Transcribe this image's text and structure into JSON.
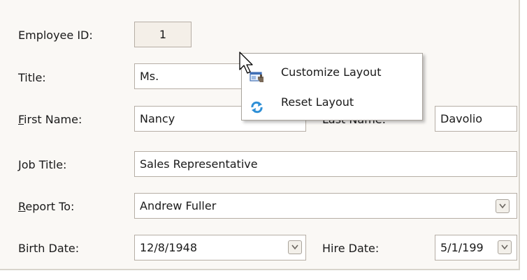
{
  "form": {
    "employee_id": {
      "label": "Employee ID:",
      "value": "1"
    },
    "title": {
      "label": "Title:",
      "value": "Ms."
    },
    "first_name": {
      "label_pre": "",
      "label_ul": "F",
      "label_post": "irst Name:",
      "value": "Nancy"
    },
    "last_name": {
      "label": "Last Name:",
      "value": "Davolio"
    },
    "job_title": {
      "label": "Job Title:",
      "value": "Sales Representative"
    },
    "report_to": {
      "label_ul": "R",
      "label_post": "eport To:",
      "value": "Andrew Fuller"
    },
    "birth_date": {
      "label": "Birth Date:",
      "value": "12/8/1948"
    },
    "hire_date": {
      "label": "Hire Date:",
      "value": "5/1/199"
    }
  },
  "context_menu": {
    "items": [
      {
        "label": "Customize Layout",
        "icon": "customize-layout-icon"
      },
      {
        "label": "Reset Layout",
        "icon": "reset-layout-icon"
      }
    ]
  }
}
